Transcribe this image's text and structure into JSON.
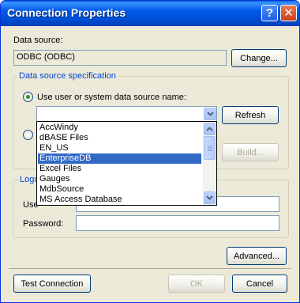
{
  "window": {
    "title": "Connection Properties",
    "help_glyph": "?",
    "close_glyph": "✕"
  },
  "data_source": {
    "label": "Data source:",
    "value": "ODBC (ODBC)",
    "change_button": "Change..."
  },
  "spec": {
    "group_title": "Data source specification",
    "radio_dsn_label": "Use user or system data source name:",
    "radio_dsn_selected": true,
    "radio_conn_selected": false,
    "refresh_button": "Refresh",
    "build_button": "Build..."
  },
  "dropdown": {
    "items": [
      {
        "label": "AccWindy"
      },
      {
        "label": "dBASE Files"
      },
      {
        "label": "EN_US"
      },
      {
        "label": "EnterpriseDB",
        "selected": true
      },
      {
        "label": "Excel Files"
      },
      {
        "label": "Gauges"
      },
      {
        "label": "MdbSource"
      },
      {
        "label": "MS Access Database"
      }
    ]
  },
  "login": {
    "group_title_visible": "Logo",
    "user_label_visible": "Use",
    "password_label": "Password:"
  },
  "footer": {
    "advanced_button": "Advanced...",
    "test_button": "Test Connection",
    "ok_button": "OK",
    "cancel_button": "Cancel"
  }
}
